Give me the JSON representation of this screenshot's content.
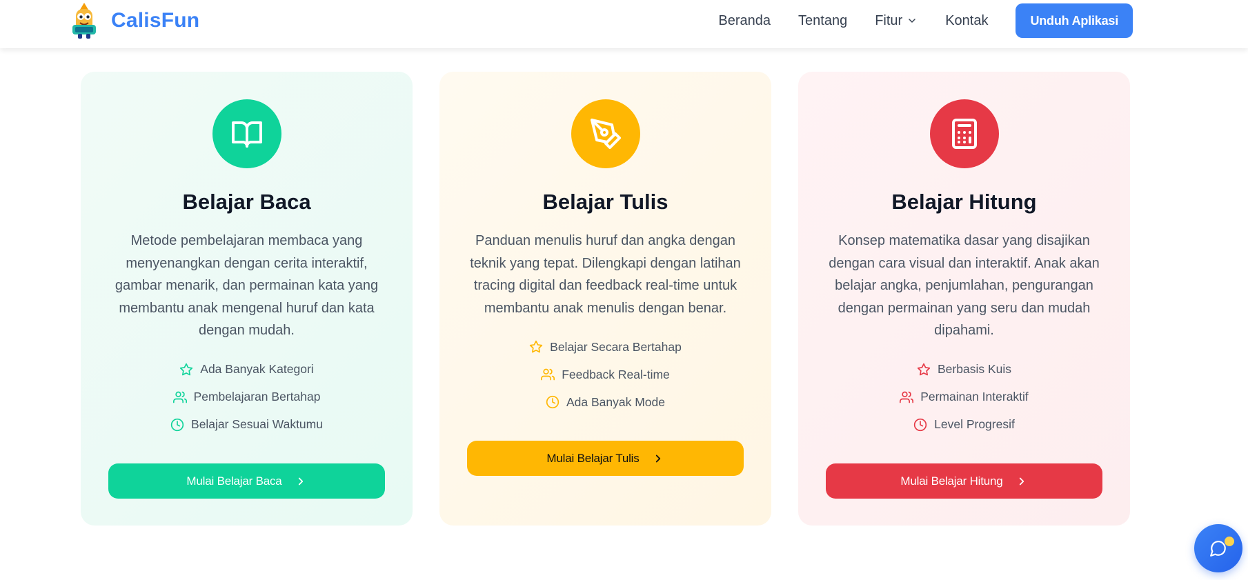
{
  "header": {
    "brand_name": "CalisFun",
    "nav": [
      "Beranda",
      "Tentang",
      "Fitur",
      "Kontak"
    ],
    "download_label": "Unduh Aplikasi",
    "accent": "#3b82f6"
  },
  "cards": [
    {
      "title": "Belajar Baca",
      "icon": "book-open-icon",
      "color": "#0fd39a",
      "description": "Metode pembelajaran membaca yang menyenangkan dengan cerita interaktif, gambar menarik, dan permainan kata yang membantu anak mengenal huruf dan kata dengan mudah.",
      "features": [
        "Ada Banyak Kategori",
        "Pembelajaran Bertahap",
        "Belajar Sesuai Waktumu"
      ],
      "button": "Mulai Belajar Baca"
    },
    {
      "title": "Belajar Tulis",
      "icon": "pen-tool-icon",
      "color": "#ffb703",
      "description": "Panduan menulis huruf dan angka dengan teknik yang tepat. Dilengkapi dengan latihan tracing digital dan feedback real-time untuk membantu anak menulis dengan benar.",
      "features": [
        "Belajar Secara Bertahap",
        "Feedback Real-time",
        "Ada Banyak Mode"
      ],
      "button": "Mulai Belajar Tulis"
    },
    {
      "title": "Belajar Hitung",
      "icon": "calculator-icon",
      "color": "#e63946",
      "description": "Konsep matematika dasar yang disajikan dengan cara visual dan interaktif. Anak akan belajar angka, penjumlahan, pengurangan dengan permainan yang seru dan mudah dipahami.",
      "features": [
        "Berbasis Kuis",
        "Permainan Interaktif",
        "Level Progresif"
      ],
      "button": "Mulai Belajar Hitung"
    }
  ],
  "feature_icons": [
    "star-icon",
    "users-icon",
    "clock-icon"
  ],
  "chat_fab": {
    "icon": "chat-icon",
    "color": "#3b82f6"
  }
}
